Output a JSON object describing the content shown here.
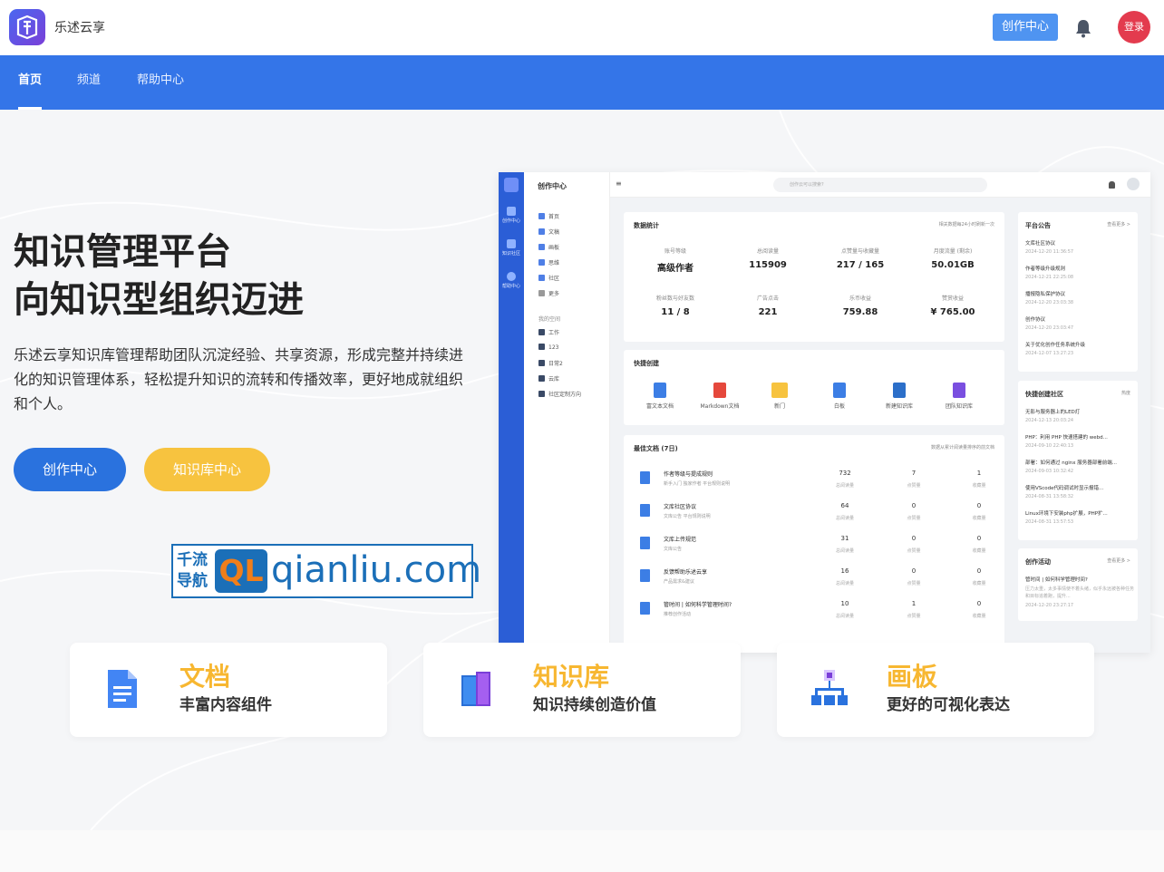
{
  "header": {
    "brand": "乐述云享",
    "create_button": "创作中心",
    "login_label": "登录"
  },
  "nav": {
    "items": [
      {
        "label": "首页",
        "active": true
      },
      {
        "label": "频道",
        "active": false
      },
      {
        "label": "帮助中心",
        "active": false
      }
    ]
  },
  "hero": {
    "title_line1": "知识管理平台",
    "title_line2": "向知识型组织迈进",
    "description": "乐述云享知识库管理帮助团队沉淀经验、共享资源，形成完整并持续进化的知识管理体系，轻松提升知识的流转和传播效率，更好地成就组织和个人。",
    "primary_button": "创作中心",
    "secondary_button": "知识库中心"
  },
  "watermark": {
    "cn_line1": "千流",
    "cn_line2": "导航",
    "logo_text": "QL",
    "url": "qianliu.com"
  },
  "dashboard": {
    "rail": [
      "创作中心",
      "知识社区",
      "帮助中心"
    ],
    "sidebar_title": "创作中心",
    "sidebar_items": [
      "首页",
      "文稿",
      "画板",
      "思维",
      "社区",
      "更多"
    ],
    "sidebar_section": "我的空间",
    "folder_items": [
      "工作",
      "123",
      "日常2",
      "云库",
      "社区定制方向"
    ],
    "search_placeholder": "创作云可以搜索?",
    "stats_card": {
      "title": "数据统计",
      "note": "相关数据每24小时刷新一次",
      "stats": [
        {
          "label": "账号等级",
          "value": "高级作者"
        },
        {
          "label": "总阅读量",
          "value": "115909"
        },
        {
          "label": "点赞量与收藏量",
          "value": "217 / 165"
        },
        {
          "label": "月度流量 (剩余)",
          "value": "50.01GB"
        },
        {
          "label": "粉丝数与好友数",
          "value": "11 / 8"
        },
        {
          "label": "广告点击",
          "value": "221"
        },
        {
          "label": "乐币收益",
          "value": "759.88"
        },
        {
          "label": "赞赏收益",
          "value": "¥ 765.00"
        }
      ]
    },
    "quick_card": {
      "title": "快捷创建",
      "items": [
        {
          "label": "富文本文档",
          "color": "#3c7ee5"
        },
        {
          "label": "Markdown文档",
          "color": "#e5483c"
        },
        {
          "label": "新门",
          "color": "#f7c33f"
        },
        {
          "label": "白板",
          "color": "#3c7ee5"
        },
        {
          "label": "新建知识库",
          "color": "#2c6fc9"
        },
        {
          "label": "团队知识库",
          "color": "#7a4fe0"
        }
      ]
    },
    "docs_card": {
      "title": "最佳文档 (7日)",
      "note": "数据从累计阅读量排序的前文档",
      "metric_labels": [
        "总阅读量",
        "点赞量",
        "收藏量"
      ],
      "rows": [
        {
          "name": "作者等级与提成规则",
          "tags": "新手入门  独家作者  平台规则说明",
          "m": [
            "732",
            "7",
            "1"
          ]
        },
        {
          "name": "文库社区协议",
          "tags": "文库公告  平台规则说明",
          "m": [
            "64",
            "0",
            "0"
          ]
        },
        {
          "name": "文库上传规范",
          "tags": "文库公告",
          "m": [
            "31",
            "0",
            "0"
          ]
        },
        {
          "name": "反馈帮助乐述云享",
          "tags": "产品需求&建议",
          "m": [
            "16",
            "0",
            "0"
          ]
        },
        {
          "name": "管时间 | 如何科学管理时间?",
          "tags": "推荐创作活动",
          "m": [
            "10",
            "1",
            "0"
          ]
        }
      ]
    },
    "announce": {
      "title": "平台公告",
      "more": "查看更多 >",
      "items": [
        {
          "text": "文库社区协议",
          "date": "2024-12-20 11:36:57"
        },
        {
          "text": "作者等级升级规则",
          "date": "2024-12-21 22:25:08"
        },
        {
          "text": "播报隐私保护协议",
          "date": "2024-12-20 23:03:38"
        },
        {
          "text": "创作协议",
          "date": "2024-12-20 23:03:47"
        },
        {
          "text": "关于优化创作任务系统升级",
          "date": "2024-12-07 13:27:23"
        }
      ]
    },
    "community": {
      "title": "快捷创建社区",
      "more": "热度",
      "items": [
        {
          "text": "无影与服务器上的LED灯",
          "date": "2024-12-13 20:03:24"
        },
        {
          "text": "PHP：利用 PHP 快速搭建的 webd...",
          "date": "2024-09-10 22:40:13"
        },
        {
          "text": "部署：如何通过 nginx 服务器部署前端...",
          "date": "2024-09-03 10:32:42"
        },
        {
          "text": "使用VScode代码调试时显示报错...",
          "date": "2024-08-31 13:58:32"
        },
        {
          "text": "Linux环境下安装php扩展，PHP扩...",
          "date": "2024-08-31 13:57:53"
        }
      ]
    },
    "activity": {
      "title": "创作活动",
      "more": "查看更多 >",
      "item_title": "管时间 | 如何科学管理时间?",
      "item_desc": "压力太重，太多事情使不着头绪，似乎永远被各种任务和目标追着跑，提升...",
      "item_date": "2024-12-20 23:27:17"
    }
  },
  "features": [
    {
      "title": "文档",
      "subtitle": "丰富内容组件",
      "icon": "document-icon"
    },
    {
      "title": "知识库",
      "subtitle": "知识持续创造价值",
      "icon": "books-icon"
    },
    {
      "title": "画板",
      "subtitle": "更好的可视化表达",
      "icon": "flowchart-icon"
    }
  ]
}
